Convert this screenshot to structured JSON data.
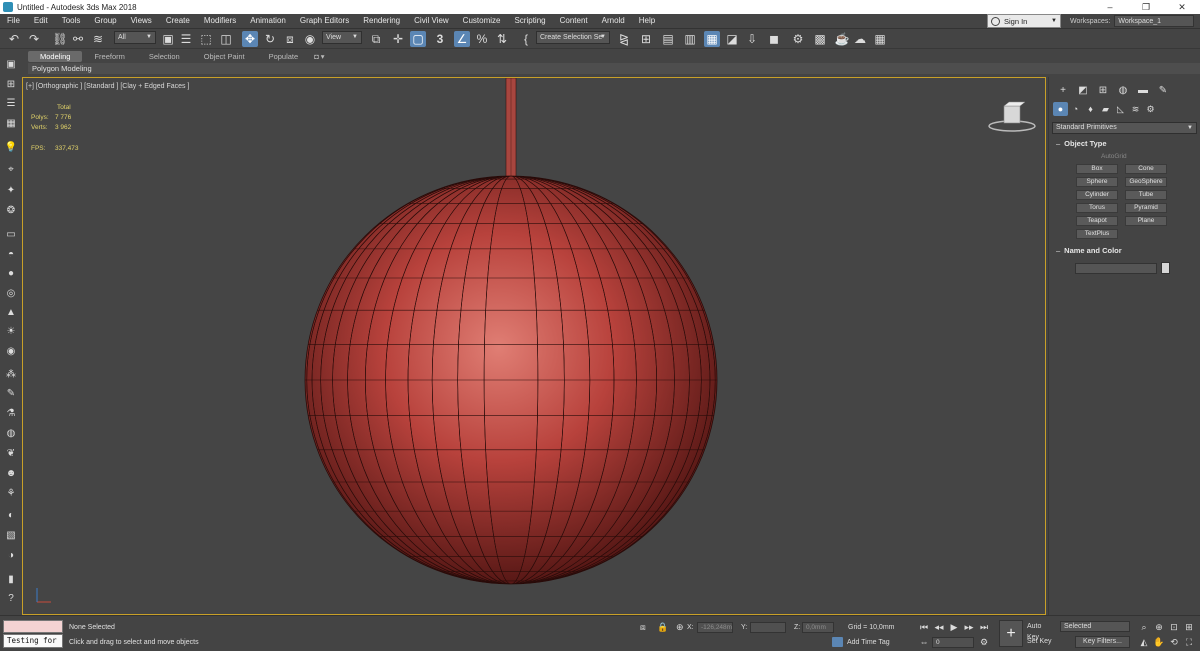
{
  "window": {
    "title": "Untitled - Autodesk 3ds Max 2018",
    "minimize": "–",
    "maximize": "❐",
    "close": "✕"
  },
  "menu": [
    "File",
    "Edit",
    "Tools",
    "Group",
    "Views",
    "Create",
    "Modifiers",
    "Animation",
    "Graph Editors",
    "Rendering",
    "Civil View",
    "Customize",
    "Scripting",
    "Content",
    "Arnold",
    "Help"
  ],
  "signin": {
    "label": "Sign In"
  },
  "workspaces": {
    "label": "Workspaces:",
    "value": "Workspace_1"
  },
  "toolbar": {
    "filter_value": "All",
    "refcoord_value": "View",
    "snap_value": "3",
    "selection_set_placeholder": "Create Selection Se"
  },
  "ribbon": {
    "tabs": [
      "Modeling",
      "Freeform",
      "Selection",
      "Object Paint",
      "Populate"
    ],
    "active_tab": "Modeling",
    "subpanel": "Polygon Modeling"
  },
  "viewport": {
    "label": "[+] [Orthographic ] [Standard ] [Clay + Edged Faces ]",
    "stats": {
      "total_label": "Total",
      "polys_label": "Polys:",
      "polys_value": "7 776",
      "verts_label": "Verts:",
      "verts_value": "3 962",
      "fps_label": "FPS:",
      "fps_value": "337,473"
    },
    "object_color": "#b8423c",
    "frame_color": "#c8a028"
  },
  "command_panel": {
    "dropdown": "Standard Primitives",
    "object_type": {
      "title": "Object Type",
      "autogrid": "AutoGrid",
      "buttons": [
        "Box",
        "Cone",
        "Sphere",
        "GeoSphere",
        "Cylinder",
        "Tube",
        "Torus",
        "Pyramid",
        "Teapot",
        "Plane",
        "TextPlus"
      ]
    },
    "name_color": {
      "title": "Name and Color"
    }
  },
  "status": {
    "maxscript_input": "Testing for :",
    "selection": "None Selected",
    "prompt": "Click and drag to select and move objects",
    "x_label": "X:",
    "x_value": "-126,248m",
    "y_label": "Y:",
    "y_value": "",
    "z_label": "Z:",
    "z_value": "0,0mm",
    "grid": "Grid = 10,0mm",
    "add_time_tag": "Add Time Tag",
    "frame": "0",
    "auto_key": "Auto Key",
    "set_key": "Set Key",
    "key_mode": "Selected",
    "key_filters": "Key Filters..."
  }
}
